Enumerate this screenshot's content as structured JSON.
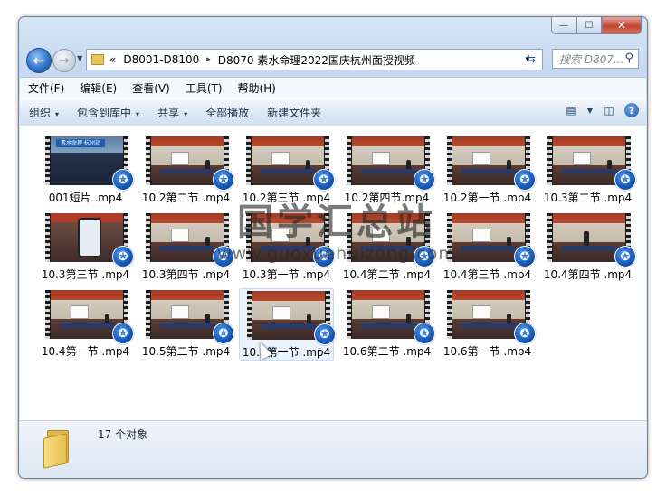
{
  "window": {
    "caption_buttons": [
      {
        "icon": "minimize-icon",
        "glyph": "—"
      },
      {
        "icon": "maximize-icon",
        "glyph": "☐"
      },
      {
        "icon": "close-icon",
        "glyph": "✕"
      }
    ]
  },
  "address_bar": {
    "overflow_glyph": "«",
    "segments": [
      "D8001-D8100",
      "D8070 素水命理2022国庆杭州面授视频"
    ],
    "separator_glyph": "▸",
    "dropdown_glyph": "▾"
  },
  "search": {
    "placeholder": "搜索 D807...",
    "icon": "search-icon"
  },
  "menubar": {
    "items": [
      "文件(F)",
      "编辑(E)",
      "查看(V)",
      "工具(T)",
      "帮助(H)"
    ]
  },
  "toolbar": {
    "items": [
      {
        "label": "组织",
        "has_arrow": true
      },
      {
        "label": "包含到库中",
        "has_arrow": true
      },
      {
        "label": "共享",
        "has_arrow": true
      },
      {
        "label": "全部播放",
        "has_arrow": false
      },
      {
        "label": "新建文件夹",
        "has_arrow": false
      }
    ],
    "arrow_glyph": "▾",
    "help_glyph": "?"
  },
  "files": [
    {
      "name": "001短片 .mp4",
      "scene": "crowd",
      "banner": "素水命理·杭州站"
    },
    {
      "name": "10.2第二节 .mp4",
      "scene": "class"
    },
    {
      "name": "10.2第三节 .mp4",
      "scene": "class"
    },
    {
      "name": "10.2第四节.mp4",
      "scene": "class"
    },
    {
      "name": "10.2第一节 .mp4",
      "scene": "class"
    },
    {
      "name": "10.3第二节 .mp4",
      "scene": "class"
    },
    {
      "name": "10.3第三节 .mp4",
      "scene": "phone"
    },
    {
      "name": "10.3第四节 .mp4",
      "scene": "class"
    },
    {
      "name": "10.3第一节 .mp4",
      "scene": "class"
    },
    {
      "name": "10.4第二节 .mp4",
      "scene": "class"
    },
    {
      "name": "10.4第三节 .mp4",
      "scene": "class"
    },
    {
      "name": "10.4第四节 .mp4",
      "scene": "stand"
    },
    {
      "name": "10.4第一节 .mp4",
      "scene": "class"
    },
    {
      "name": "10.5第二节 .mp4",
      "scene": "class"
    },
    {
      "name": "10.5第一节 .mp4",
      "scene": "class",
      "selected": true
    },
    {
      "name": "10.6第二节 .mp4",
      "scene": "class"
    },
    {
      "name": "10.6第一节 .mp4",
      "scene": "class"
    }
  ],
  "badge_glyph": "✪",
  "status": {
    "count_text": "17 个对象"
  },
  "watermark": {
    "title": "国学汇总站",
    "url": "www.guoxuehuizong.com"
  }
}
